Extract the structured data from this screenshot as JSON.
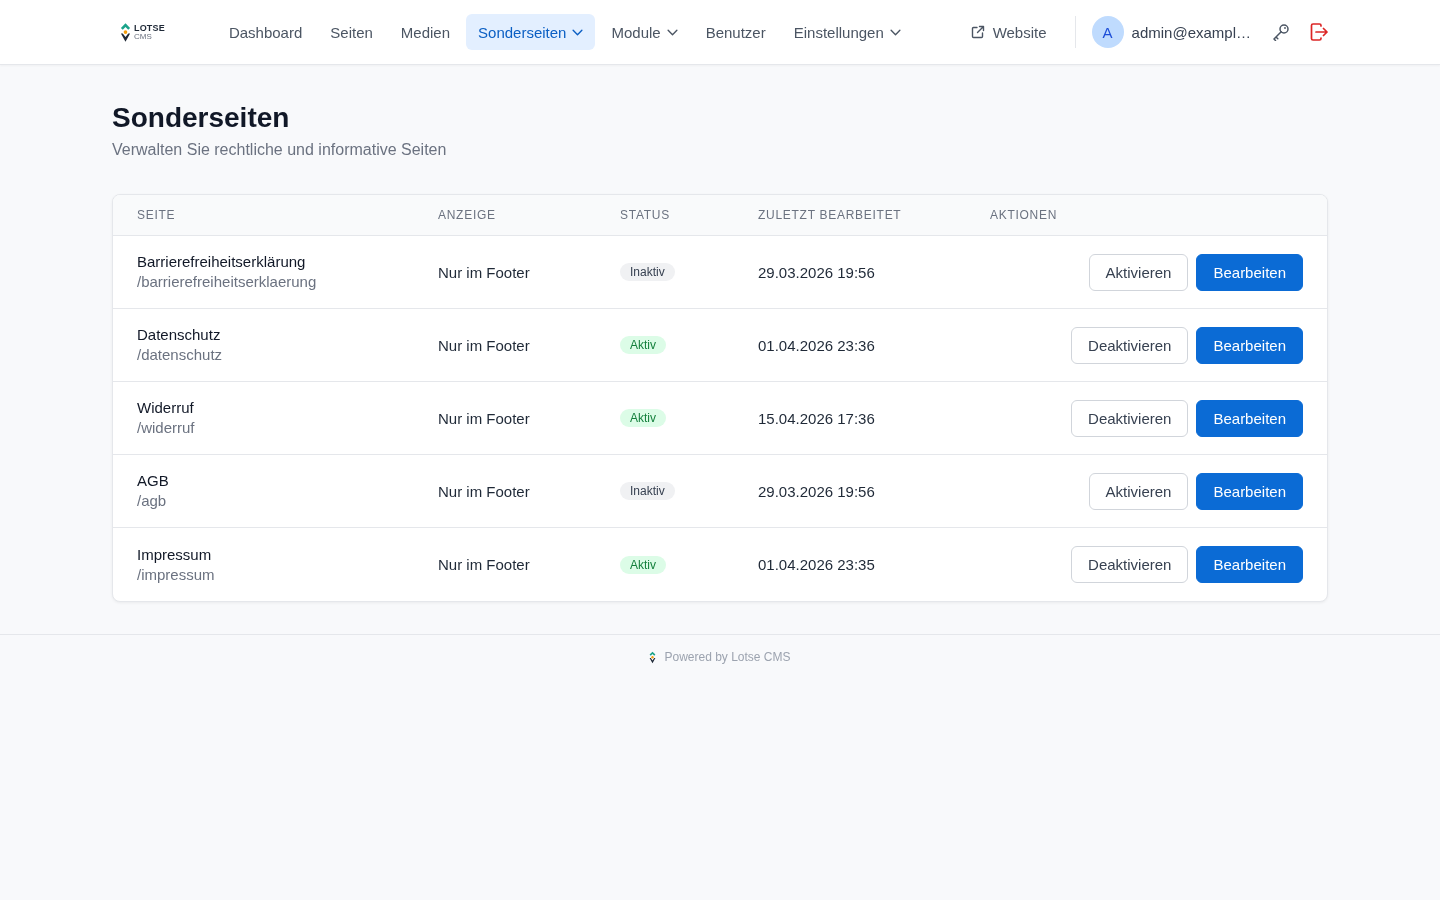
{
  "brand": {
    "name": "LOTSE",
    "subtitle": "CMS"
  },
  "nav": [
    {
      "label": "Dashboard",
      "selected": false,
      "has_menu": false
    },
    {
      "label": "Seiten",
      "selected": false,
      "has_menu": false
    },
    {
      "label": "Medien",
      "selected": false,
      "has_menu": false
    },
    {
      "label": "Sonderseiten",
      "selected": true,
      "has_menu": true
    },
    {
      "label": "Module",
      "selected": false,
      "has_menu": true
    },
    {
      "label": "Benutzer",
      "selected": false,
      "has_menu": false
    },
    {
      "label": "Einstellungen",
      "selected": false,
      "has_menu": true
    }
  ],
  "website_link": "Website",
  "user": {
    "initial": "A",
    "email": "admin@exampl…"
  },
  "page": {
    "title": "Sonderseiten",
    "subtitle": "Verwalten Sie rechtliche und informative Seiten"
  },
  "table": {
    "columns": [
      "SEITE",
      "ANZEIGE",
      "STATUS",
      "ZULETZT BEARBEITET",
      "AKTIONEN"
    ],
    "rows": [
      {
        "title": "Barrierefreiheitserklärung",
        "slug": "/barrierefreiheitserklaerung",
        "display": "Nur im Footer",
        "status": "Inaktiv",
        "active": false,
        "edited": "29.03.2026 19:56",
        "toggle_label": "Aktivieren",
        "edit_label": "Bearbeiten"
      },
      {
        "title": "Datenschutz",
        "slug": "/datenschutz",
        "display": "Nur im Footer",
        "status": "Aktiv",
        "active": true,
        "edited": "01.04.2026 23:36",
        "toggle_label": "Deaktivieren",
        "edit_label": "Bearbeiten"
      },
      {
        "title": "Widerruf",
        "slug": "/widerruf",
        "display": "Nur im Footer",
        "status": "Aktiv",
        "active": true,
        "edited": "15.04.2026 17:36",
        "toggle_label": "Deaktivieren",
        "edit_label": "Bearbeiten"
      },
      {
        "title": "AGB",
        "slug": "/agb",
        "display": "Nur im Footer",
        "status": "Inaktiv",
        "active": false,
        "edited": "29.03.2026 19:56",
        "toggle_label": "Aktivieren",
        "edit_label": "Bearbeiten"
      },
      {
        "title": "Impressum",
        "slug": "/impressum",
        "display": "Nur im Footer",
        "status": "Aktiv",
        "active": true,
        "edited": "01.04.2026 23:35",
        "toggle_label": "Deaktivieren",
        "edit_label": "Bearbeiten"
      }
    ]
  },
  "footer": {
    "text": "Powered by Lotse CMS"
  }
}
